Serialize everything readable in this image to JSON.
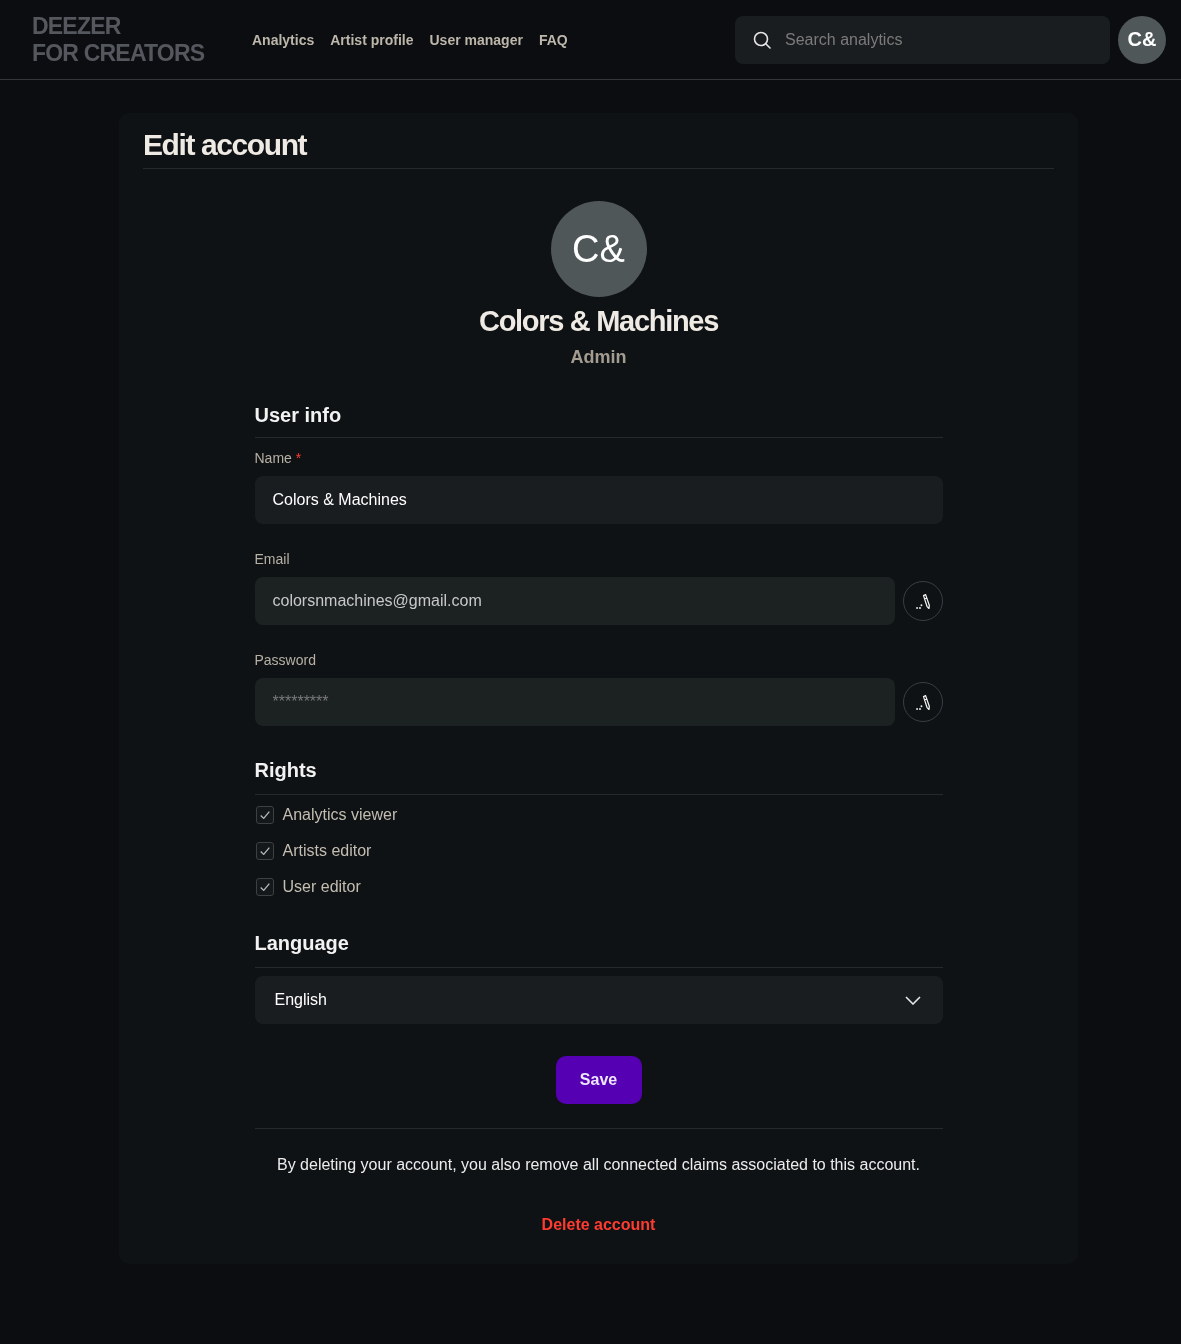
{
  "header": {
    "logo": [
      "DEEZER",
      "FOR CREATORS"
    ],
    "nav": [
      {
        "label": "Analytics"
      },
      {
        "label": "Artist profile"
      },
      {
        "label": "User manager"
      },
      {
        "label": "FAQ"
      }
    ],
    "search": {
      "placeholder": "Search analytics"
    },
    "avatar": {
      "initials": "C&"
    }
  },
  "card": {
    "title": "Edit account"
  },
  "profile": {
    "initials": "C&",
    "name": "Colors & Machines",
    "role": "Admin"
  },
  "user_info": {
    "heading": "User info",
    "fields": [
      {
        "kind": "plain",
        "label": "Name",
        "required_mark": "*",
        "value": "Colors & Machines"
      },
      {
        "kind": "locked",
        "label": "Email",
        "value": "colorsnmachines@gmail.com"
      },
      {
        "kind": "locked",
        "label": "Password",
        "placeholder": "*********"
      }
    ]
  },
  "rights": {
    "heading": "Rights",
    "items": [
      {
        "label": "Analytics viewer",
        "checked": true
      },
      {
        "label": "Artists editor",
        "checked": true
      },
      {
        "label": "User editor",
        "checked": true
      }
    ]
  },
  "language": {
    "heading": "Language",
    "value": "English"
  },
  "save_button": "Save",
  "delete_notice": "By deleting your account, you also remove all connected claims associated to this account.",
  "delete_link": "Delete account"
}
